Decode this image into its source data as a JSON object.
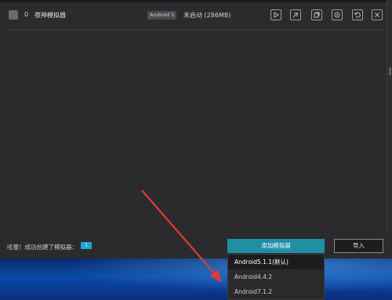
{
  "emulator_row": {
    "index": "0",
    "name": "夜神模拟器",
    "android_badge": "Android 5",
    "status": "未启动 (286MB)",
    "actions": [
      "play-icon",
      "delete-icon",
      "clone-icon",
      "settings-icon",
      "restore-icon",
      "close-icon"
    ]
  },
  "footer": {
    "success_text": "哇塞！成功创建了模拟器：",
    "created_count": "1",
    "add_button": "添加模拟器",
    "import_button": "导入"
  },
  "dropdown": {
    "options": [
      "Android5.1.1(默认)",
      "Android4.4.2",
      "Android7.1.2"
    ]
  },
  "colors": {
    "accent": "#1f8fa6",
    "badge": "#1fa6d2",
    "arrow": "#e03a3a"
  }
}
